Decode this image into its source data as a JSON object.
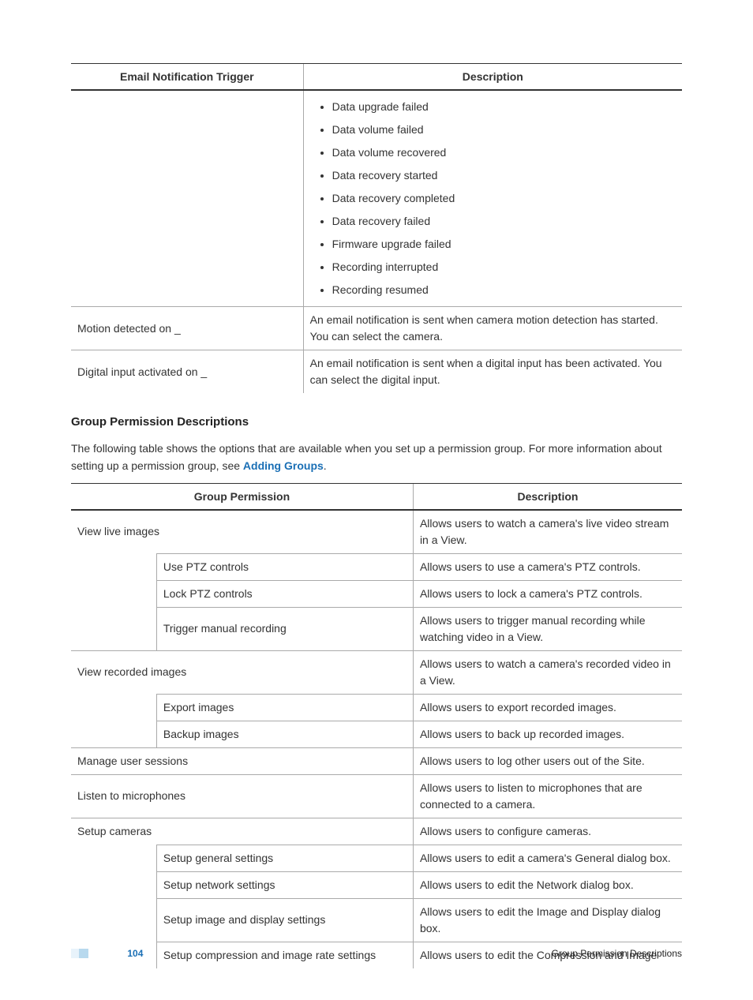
{
  "table1": {
    "headers": [
      "Email Notification Trigger",
      "Description"
    ],
    "row0_bullets": [
      "Data upgrade failed",
      "Data volume failed",
      "Data volume recovered",
      "Data recovery started",
      "Data recovery completed",
      "Data recovery failed",
      "Firmware upgrade failed",
      "Recording interrupted",
      "Recording resumed"
    ],
    "row1": {
      "trigger": "Motion detected on _",
      "desc": "An email notification is sent when camera motion detection has started. You can select the camera."
    },
    "row2": {
      "trigger": "Digital input activated on _",
      "desc": "An email notification is sent when a digital input has been activated. You can select the digital input."
    }
  },
  "section": {
    "heading": "Group Permission Descriptions",
    "para_before": "The following table shows the options that are available when you set up a permission group. For more information about setting up a permission group, see ",
    "link_text": "Adding Groups",
    "para_after": "."
  },
  "table2": {
    "headers": [
      "Group Permission",
      "Description"
    ],
    "rows": [
      {
        "span": true,
        "perm": "View live images",
        "desc": "Allows users to watch a camera's live video stream in a View."
      },
      {
        "span": false,
        "perm": "Use PTZ controls",
        "desc": "Allows users to use a camera's PTZ controls."
      },
      {
        "span": false,
        "perm": "Lock PTZ controls",
        "desc": "Allows users to lock a camera's PTZ controls."
      },
      {
        "span": false,
        "perm": "Trigger manual recording",
        "desc": "Allows users to trigger manual recording while watching video in a View."
      },
      {
        "span": true,
        "perm": "View recorded images",
        "desc": "Allows users to watch a camera's recorded video in a View."
      },
      {
        "span": false,
        "perm": "Export images",
        "desc": "Allows users to export recorded images."
      },
      {
        "span": false,
        "perm": "Backup images",
        "desc": "Allows users to back up recorded images."
      },
      {
        "span": true,
        "perm": "Manage user sessions",
        "desc": "Allows users to log other users out of the Site."
      },
      {
        "span": true,
        "perm": "Listen to microphones",
        "desc": "Allows users to listen to microphones that are connected to a camera."
      },
      {
        "span": true,
        "perm": "Setup cameras",
        "desc": "Allows users to configure cameras."
      },
      {
        "span": false,
        "perm": "Setup general settings",
        "desc": "Allows users to edit a camera's General dialog box."
      },
      {
        "span": false,
        "perm": "Setup network settings",
        "desc": "Allows users to edit the Network dialog box."
      },
      {
        "span": false,
        "perm": "Setup image and display settings",
        "desc": "Allows users to edit the Image and Display dialog box."
      },
      {
        "span": false,
        "perm": "Setup compression and image rate settings",
        "desc": "Allows users to edit the Compression and Image"
      }
    ]
  },
  "footer": {
    "page_number": "104",
    "right_text": "Group Permission Descriptions"
  }
}
